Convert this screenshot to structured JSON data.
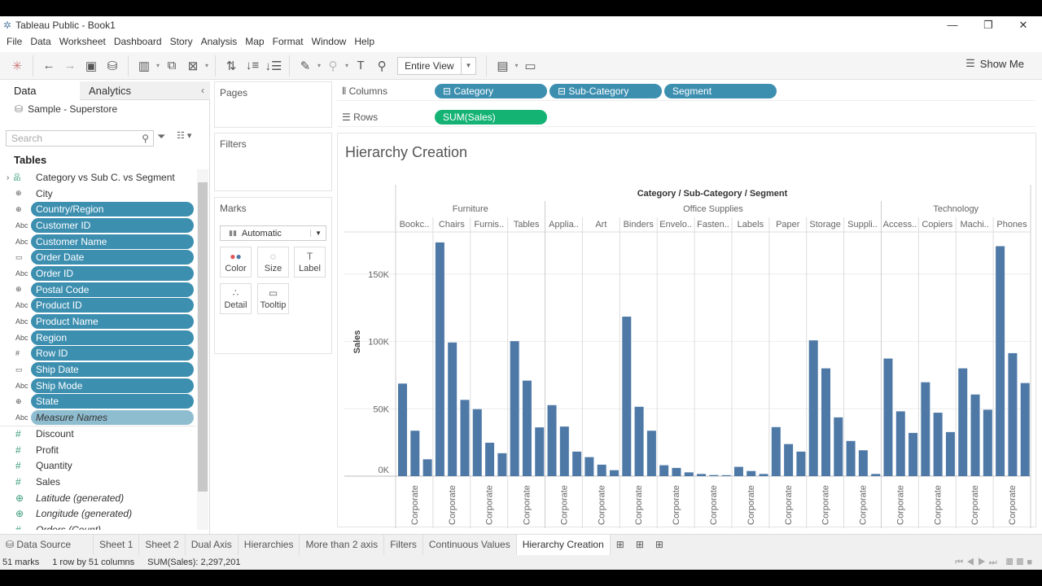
{
  "window": {
    "title": "Tableau Public - Book1",
    "minimize": "—",
    "restore": "❐",
    "close": "✕"
  },
  "menu": [
    "File",
    "Data",
    "Worksheet",
    "Dashboard",
    "Story",
    "Analysis",
    "Map",
    "Format",
    "Window",
    "Help"
  ],
  "toolbar": {
    "fit": "Entire View",
    "show_me": "Show Me"
  },
  "datapane": {
    "tab_data": "Data",
    "tab_analytics": "Analytics",
    "datasource": "Sample - Superstore",
    "search_placeholder": "Search",
    "tables_header": "Tables",
    "fields": [
      {
        "icon": "hierarchy",
        "type": "&#x2AEF;",
        "name": "Category vs Sub C. vs Segment",
        "state": "normal"
      },
      {
        "icon": "globe",
        "type": "⊕",
        "name": "City",
        "state": "normal"
      },
      {
        "icon": "globe",
        "type": "⊕",
        "name": "Country/Region",
        "state": "selected"
      },
      {
        "icon": "abc",
        "type": "Abc",
        "name": "Customer ID",
        "state": "selected"
      },
      {
        "icon": "abc",
        "type": "Abc",
        "name": "Customer Name",
        "state": "selected"
      },
      {
        "icon": "calendar",
        "type": "▭",
        "name": "Order Date",
        "state": "selected"
      },
      {
        "icon": "abc",
        "type": "Abc",
        "name": "Order ID",
        "state": "selected"
      },
      {
        "icon": "globe",
        "type": "⊕",
        "name": "Postal Code",
        "state": "selected"
      },
      {
        "icon": "abc",
        "type": "Abc",
        "name": "Product ID",
        "state": "selected"
      },
      {
        "icon": "abc",
        "type": "Abc",
        "name": "Product Name",
        "state": "selected"
      },
      {
        "icon": "abc",
        "type": "Abc",
        "name": "Region",
        "state": "selected"
      },
      {
        "icon": "number",
        "type": "#",
        "name": "Row ID",
        "state": "selected"
      },
      {
        "icon": "calendar",
        "type": "▭",
        "name": "Ship Date",
        "state": "selected"
      },
      {
        "icon": "abc",
        "type": "Abc",
        "name": "Ship Mode",
        "state": "selected"
      },
      {
        "icon": "globe",
        "type": "⊕",
        "name": "State",
        "state": "selected"
      },
      {
        "icon": "abc",
        "type": "Abc",
        "name": "Measure Names",
        "state": "measure-names"
      },
      {
        "icon": "number",
        "type": "#",
        "name": "Discount",
        "state": "measure"
      },
      {
        "icon": "number",
        "type": "#",
        "name": "Profit",
        "state": "measure"
      },
      {
        "icon": "number",
        "type": "#",
        "name": "Quantity",
        "state": "measure"
      },
      {
        "icon": "number",
        "type": "#",
        "name": "Sales",
        "state": "measure"
      },
      {
        "icon": "globe",
        "type": "⊕",
        "name": "Latitude (generated)",
        "state": "measure-italic"
      },
      {
        "icon": "globe",
        "type": "⊕",
        "name": "Longitude (generated)",
        "state": "measure-italic"
      },
      {
        "icon": "number",
        "type": "#",
        "name": "Orders (Count)",
        "state": "measure-italic"
      }
    ]
  },
  "cards": {
    "pages": "Pages",
    "filters": "Filters",
    "marks": "Marks",
    "mark_type": "Automatic",
    "mark_buttons": [
      {
        "icon": "color",
        "label": "Color"
      },
      {
        "icon": "size",
        "label": "Size"
      },
      {
        "icon": "label",
        "label": "Label"
      },
      {
        "icon": "detail",
        "label": "Detail"
      },
      {
        "icon": "tooltip",
        "label": "Tooltip"
      }
    ]
  },
  "shelves": {
    "columns_label": "Columns",
    "rows_label": "Rows",
    "columns": [
      "Category",
      "Sub-Category",
      "Segment"
    ],
    "rows": [
      "SUM(Sales)"
    ]
  },
  "sheet_title": "Hierarchy Creation",
  "chart_data": {
    "type": "bar",
    "header_title": "Category / Sub-Category / Segment",
    "ylabel": "Sales",
    "yticks": [
      "0K",
      "50K",
      "100K",
      "150K"
    ],
    "ylim": [
      0,
      180000
    ],
    "grid": true,
    "bar_color": "#4e79a7",
    "segment_label_visible": "Corporate",
    "categories": [
      {
        "name": "Furniture",
        "subcategories": [
          {
            "label": "Bookc..",
            "values": [
              68700,
              33700,
              12500
            ]
          },
          {
            "label": "Chairs",
            "values": [
              173500,
              99200,
              56600
            ]
          },
          {
            "label": "Furnis..",
            "values": [
              49700,
              24800,
              17000
            ]
          },
          {
            "label": "Tables",
            "values": [
              100200,
              70900,
              36200
            ]
          }
        ]
      },
      {
        "name": "Office Supplies",
        "subcategories": [
          {
            "label": "Applia..",
            "values": [
              52700,
              36800,
              18200
            ]
          },
          {
            "label": "Art",
            "values": [
              14100,
              8500,
              4400
            ]
          },
          {
            "label": "Binders",
            "values": [
              118400,
              51500,
              33700
            ]
          },
          {
            "label": "Envelo..",
            "values": [
              8100,
              6100,
              2800
            ]
          },
          {
            "label": "Fasten..",
            "values": [
              1600,
              800,
              700
            ]
          },
          {
            "label": "Labels",
            "values": [
              6900,
              3800,
              1600
            ]
          },
          {
            "label": "Paper",
            "values": [
              36400,
              23800,
              18200
            ]
          },
          {
            "label": "Storage",
            "values": [
              100800,
              80000,
              43600
            ]
          },
          {
            "label": "Suppli..",
            "values": [
              26100,
              19200,
              1600
            ]
          }
        ]
      },
      {
        "name": "Technology",
        "subcategories": [
          {
            "label": "Access..",
            "values": [
              87300,
              48100,
              32100
            ]
          },
          {
            "label": "Copiers",
            "values": [
              69700,
              47100,
              32700
            ]
          },
          {
            "label": "Machi..",
            "values": [
              80000,
              60600,
              49300
            ]
          },
          {
            "label": "Phones",
            "values": [
              170700,
              91300,
              69100
            ]
          }
        ]
      }
    ]
  },
  "sheet_tabs": {
    "data_source": "Data Source",
    "tabs": [
      "Sheet 1",
      "Sheet 2",
      "Dual Axis",
      "Hierarchies",
      "More than 2 axis",
      "Filters",
      "Continuous Values",
      "Hierarchy Creation"
    ],
    "active": "Hierarchy Creation"
  },
  "status": {
    "marks": "51 marks",
    "dims": "1 row by 51 columns",
    "sum": "SUM(Sales): 2,297,201"
  }
}
